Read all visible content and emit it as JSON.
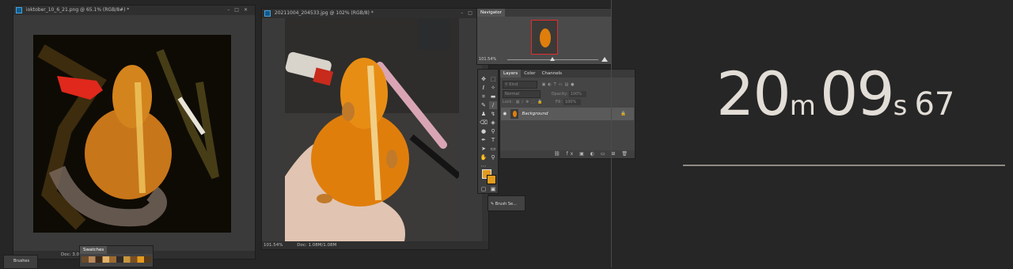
{
  "doc1": {
    "title": "ioktober_10_6_21.png @ 65.1% (RGB/8#) *",
    "status": "Doc: 3.00M/3.00M"
  },
  "doc2": {
    "title": "20211004_204533.jpg @ 102% (RGB/8) *",
    "zoom": "101.54%",
    "status": "Doc: 1.08M/1.08M"
  },
  "navigator": {
    "tab": "Navigator",
    "zoom": "101.54%"
  },
  "layers": {
    "tabs": [
      "Layers",
      "Color",
      "Channels"
    ],
    "kind_placeholder": "Kind",
    "blend_mode": "Normal",
    "opacity_label": "Opacity:",
    "opacity_value": "100%",
    "lock_label": "Lock:",
    "fill_label": "Fill:",
    "fill_value": "100%",
    "layer_name": "Background"
  },
  "brush_settings": {
    "label": "Brush Se..."
  },
  "swatches": {
    "tab": "Swatches"
  },
  "bottom_left_panel": {
    "label": "Brushes"
  },
  "timer": {
    "minutes": "20",
    "minutes_unit": "m",
    "seconds": "09",
    "seconds_unit": "s",
    "hundredths": "67"
  },
  "colors": {
    "accent_orange": "#e39b1e",
    "timer_text": "#e2ddd6",
    "timer_line": "#8e8a84",
    "background": "#262626"
  }
}
